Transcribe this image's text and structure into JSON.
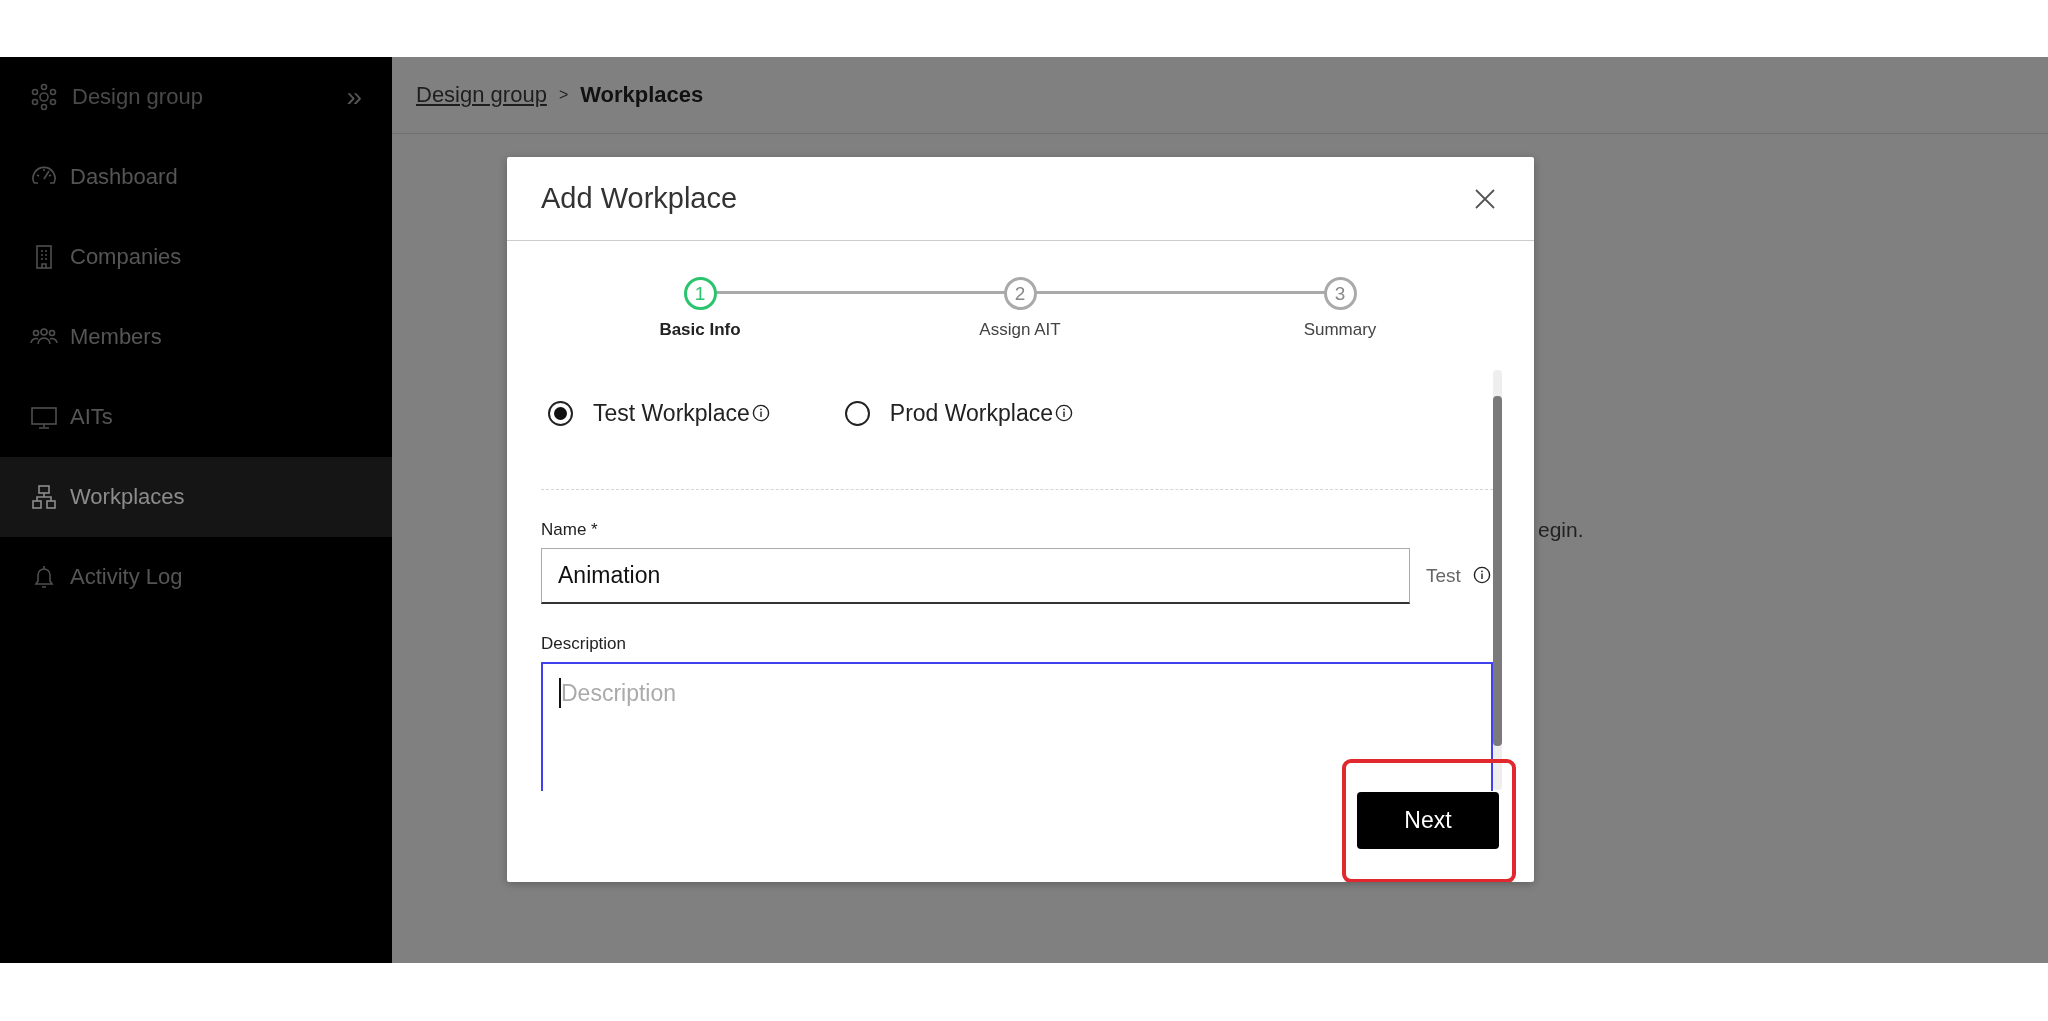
{
  "sidebar": {
    "title": "Design group",
    "collapse_glyph": "»",
    "items": [
      {
        "label": "Dashboard",
        "selected": false
      },
      {
        "label": "Companies",
        "selected": false
      },
      {
        "label": "Members",
        "selected": false
      },
      {
        "label": "AITs",
        "selected": false
      },
      {
        "label": "Workplaces",
        "selected": true
      },
      {
        "label": "Activity Log",
        "selected": false
      }
    ]
  },
  "breadcrumb": {
    "items": [
      {
        "label": "Design group",
        "kind": "link"
      },
      {
        "label": "Workplaces",
        "kind": "current"
      }
    ],
    "separator": ">"
  },
  "background_text": "egin.",
  "dialog": {
    "title": "Add Workplace",
    "steps": [
      {
        "number": "1",
        "label": "Basic Info",
        "selected": true
      },
      {
        "number": "2",
        "label": "Assign AIT",
        "selected": false
      },
      {
        "number": "3",
        "label": "Summary",
        "selected": false
      }
    ],
    "workplace_types": [
      {
        "label": "Test Workplace",
        "selected": true
      },
      {
        "label": "Prod Workplace",
        "selected": false
      }
    ],
    "fields": [
      {
        "kind": "text",
        "label": "Name *",
        "value": "Animation",
        "note": "Test"
      },
      {
        "kind": "textarea",
        "label": "Description",
        "placeholder": "Description",
        "focused": true
      }
    ],
    "buttons": [
      {
        "label": "Next",
        "highlighted": true
      }
    ]
  }
}
